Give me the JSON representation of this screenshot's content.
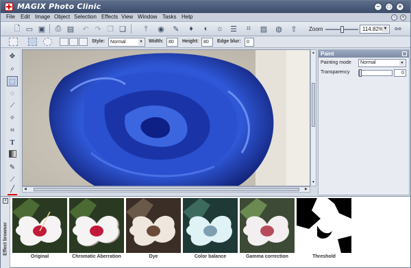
{
  "app": {
    "title": "MAGIX Photo Clinic"
  },
  "window_buttons": {
    "minimize": "–",
    "maximize": "□",
    "close": "×"
  },
  "menu": [
    "File",
    "Edit",
    "Image",
    "Object",
    "Selection",
    "Effects",
    "View",
    "Window",
    "Tasks",
    "Help"
  ],
  "mdi_buttons": {
    "restore": "◦",
    "close": "×"
  },
  "toolbar": {
    "zoom_label": "Zoom",
    "zoom_value": "114.82%",
    "zoom_slider_fraction": 0.52,
    "icons": [
      "new-file-icon",
      "open-folder-icon",
      "save-icon",
      "print-icon",
      "scan-icon",
      "undo-icon",
      "redo-icon",
      "copy-icon",
      "paste-icon",
      "levels-icon",
      "eye-icon",
      "brush-icon",
      "drop-icon",
      "contrast-icon",
      "sun-icon",
      "list-icon",
      "crop-icon",
      "image-icon",
      "globe-icon",
      "export-icon",
      "binoculars-icon"
    ]
  },
  "options": {
    "style_label": "Style:",
    "style_value": "Normal",
    "width_label": "Width:",
    "width_value": "80",
    "height_label": "Height:",
    "height_value": "80",
    "edge_blur_label": "Edge blur:",
    "edge_blur_value": "0"
  },
  "tools": [
    "move-icon",
    "zoom-icon",
    "rect-select-icon",
    "lasso-icon",
    "brush-tool-icon",
    "magic-wand-icon",
    "crop-tool-icon",
    "text-tool-icon",
    "gradient-icon",
    "pencil-icon",
    "pipette-icon",
    "color-picker-icon"
  ],
  "panel": {
    "title": "Paint",
    "painting_mode_label": "Painting mode",
    "painting_mode_value": "Normal",
    "transparency_label": "Transparency",
    "transparency_value": "0"
  },
  "effects": {
    "browser_label": "Effect browser",
    "items": [
      "Original",
      "Chromatic Aberration",
      "Dye",
      "Color balance",
      "Gamma correction",
      "Threshold"
    ]
  }
}
